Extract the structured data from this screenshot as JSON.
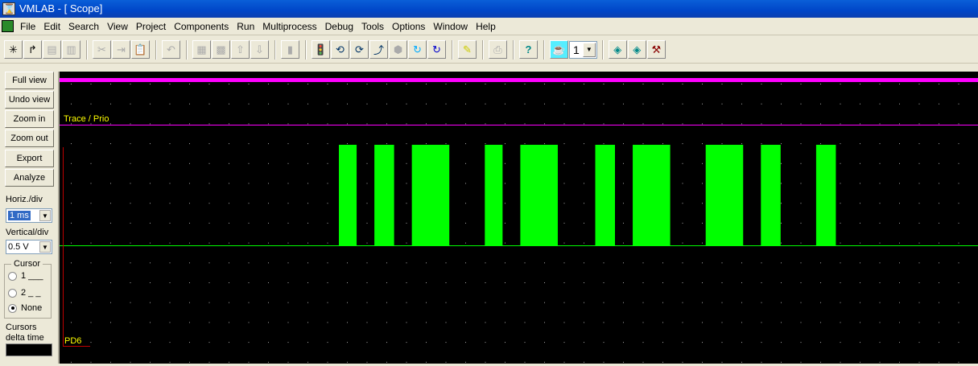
{
  "window": {
    "title": "VMLAB - [ Scope]"
  },
  "menu": [
    "File",
    "Edit",
    "Search",
    "View",
    "Project",
    "Components",
    "Run",
    "Multiprocess",
    "Debug",
    "Tools",
    "Options",
    "Window",
    "Help"
  ],
  "toolbar": {
    "process_select": "1"
  },
  "panel": {
    "buttons": [
      "Full view",
      "Undo view",
      "Zoom in",
      "Zoom out",
      "Export",
      "Analyze"
    ],
    "horiz_label": "Horiz./div",
    "horiz_value": "1 ms",
    "vert_label": "Vertical/div",
    "vert_value": "0.5 V",
    "cursor_label": "Cursor",
    "cursor_options": [
      "1 ___",
      "2 _ _",
      "None"
    ],
    "cursor_selected": "None",
    "delta_label1": "Cursors",
    "delta_label2": "delta time"
  },
  "scope": {
    "trace_label": "Trace / Prio",
    "signal_label": "PD6",
    "colors": {
      "trace": "#ff00ff",
      "signal": "#00ff00",
      "cursor": "#c00000",
      "label": "#ffff00"
    },
    "pulses_ms": [
      [
        14.0,
        14.9
      ],
      [
        15.8,
        16.8
      ],
      [
        17.7,
        19.6
      ],
      [
        21.4,
        22.3
      ],
      [
        23.2,
        25.1
      ],
      [
        27.0,
        28.0
      ],
      [
        28.9,
        30.8
      ],
      [
        32.6,
        34.5
      ],
      [
        35.4,
        36.4
      ],
      [
        38.2,
        39.2
      ]
    ]
  }
}
